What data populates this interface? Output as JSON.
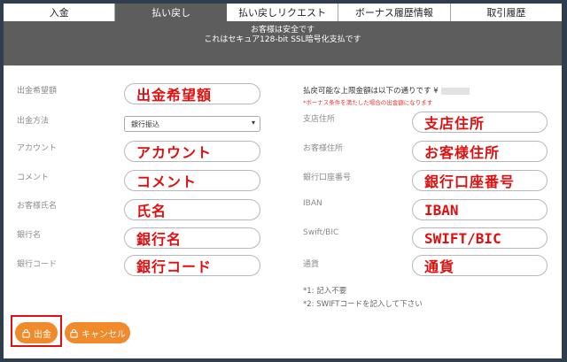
{
  "tabs": [
    "入金",
    "払い戻し",
    "払い戻しリクエスト",
    "ボーナス履歴情報",
    "取引履歴"
  ],
  "band": {
    "line1": "お客様は安全です",
    "line2": "これはセキュア128-bit SSL暗号化支払です"
  },
  "left": {
    "amount_label": "出金希望額",
    "amount_value": "出金希望額",
    "method_label": "出金方法",
    "method_value": "銀行振込",
    "account_label": "アカウント",
    "account_value": "アカウント",
    "comment_label": "コメント",
    "comment_value": "コメント",
    "name_label": "お客様氏名",
    "name_value": "氏名",
    "bank_label": "銀行名",
    "bank_value": "銀行名",
    "bankcode_label": "銀行コード",
    "bankcode_value": "銀行コード"
  },
  "right": {
    "limit_text": "払戻可能な上限金額は以下の通りです ¥",
    "bonus_note": "*ボーナス条件を満たした場合の出金額になります",
    "branch_label": "支店住所",
    "branch_value": "支店住所",
    "address_label": "お客様住所",
    "address_value": "お客様住所",
    "accno_label": "銀行口座番号",
    "accno_value": "銀行口座番号",
    "iban_label": "IBAN",
    "iban_value": "IBAN",
    "swift_label": "Swift/BIC",
    "swift_value": "SWIFT/BIC",
    "currency_label": "通貨",
    "currency_value": "通貨"
  },
  "footnotes": [
    "*1: 記入不要",
    "*2: SWIFTコードを記入して下さい"
  ],
  "buttons": {
    "withdraw": "出金",
    "cancel": "キャンセル"
  },
  "colors": {
    "accent": "#f08a2a",
    "highlight": "#e01010",
    "value_text": "#e01010"
  }
}
